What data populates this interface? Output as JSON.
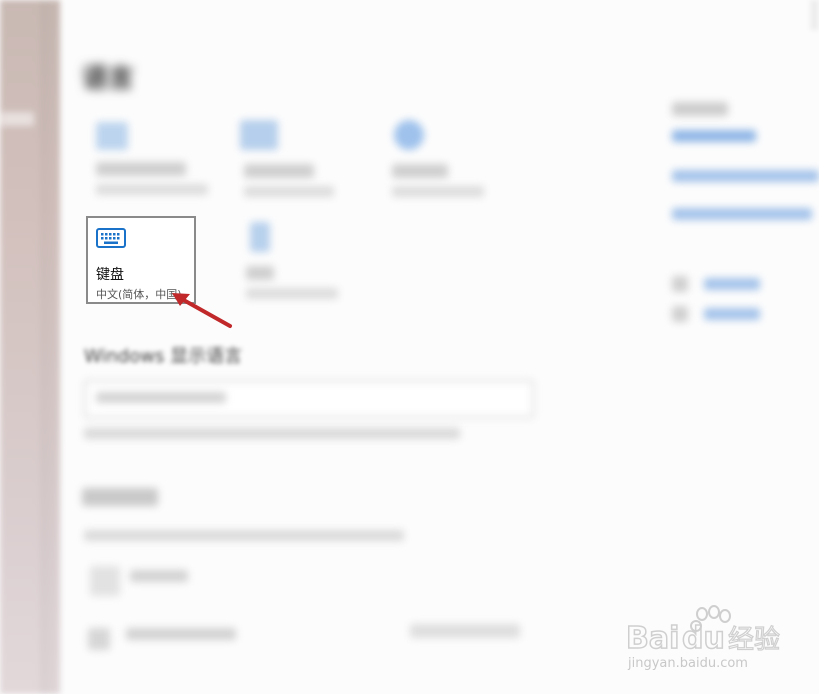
{
  "page": {
    "blurred_title": "语言",
    "blurred_section": "Windows 显示语言"
  },
  "keyboard_tile": {
    "name": "键盘",
    "subtitle": "中文(简体，中国)",
    "icon": "keyboard-icon",
    "accent_color": "#1a73c9"
  },
  "annotation": {
    "arrow_color": "#c0282a"
  },
  "watermark": {
    "brand": "Baidu经验",
    "url": "jingyan.baidu.com"
  }
}
